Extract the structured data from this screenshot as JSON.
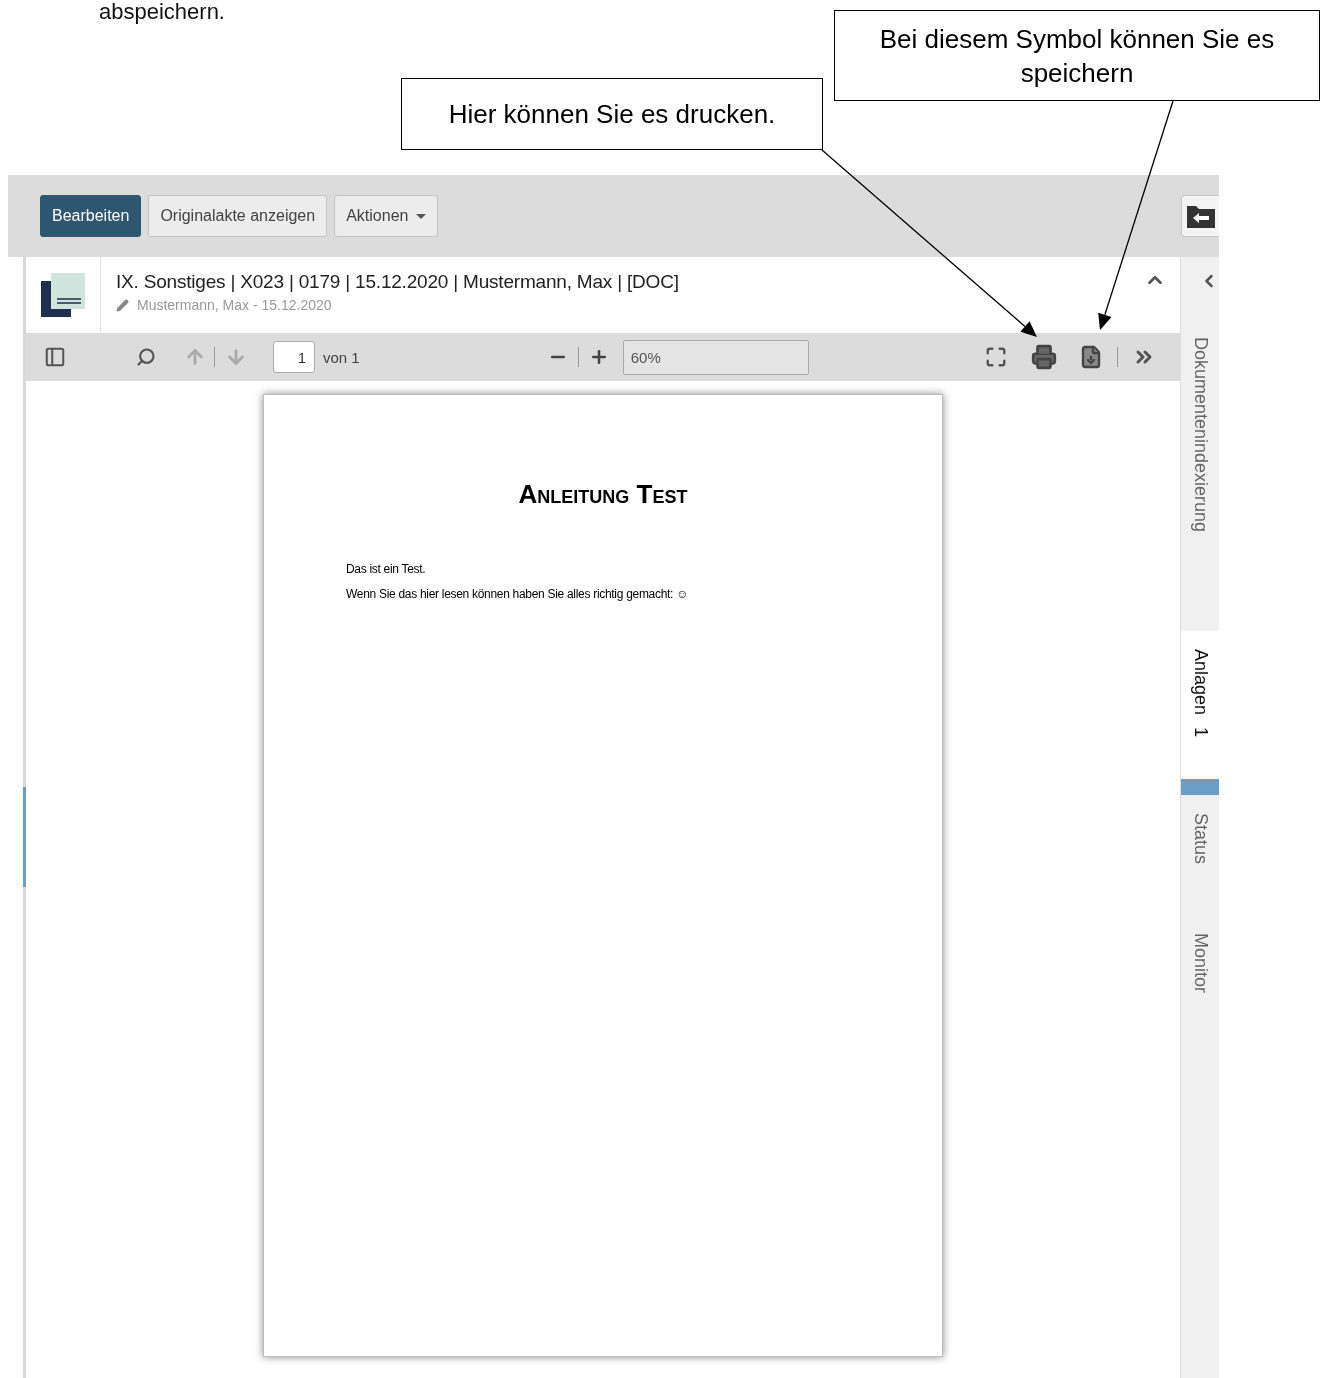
{
  "intro_fragment": "abspeichern.",
  "callouts": [
    {
      "text": "Hier können Sie es drucken."
    },
    {
      "text": "Bei diesem Symbol können Sie es speichern"
    }
  ],
  "toolbar": {
    "buttons": [
      {
        "label": "Bearbeiten",
        "kind": "primary"
      },
      {
        "label": "Originalakte anzeigen",
        "kind": "default"
      },
      {
        "label": "Aktionen",
        "kind": "dropdown"
      }
    ]
  },
  "document": {
    "title": "IX. Sonstiges | X023 | 0179 | 15.12.2020 | Mustermann, Max | [DOC]",
    "meta": "Mustermann, Max - 15.12.2020"
  },
  "viewer": {
    "page": "1",
    "page_total": "von 1",
    "zoom": "60%"
  },
  "page": {
    "heading": "Anleitung Test",
    "paragraphs": [
      "Das ist ein Test.",
      "Wenn Sie das hier lesen können haben Sie alles richtig gemacht: ☺"
    ]
  },
  "side_tabs": [
    {
      "label": "Dokumentenindexierung",
      "selected": false
    },
    {
      "label": "Anlagen",
      "count": "1",
      "selected": true
    },
    {
      "label": "Status",
      "selected": false
    },
    {
      "label": "Monitor",
      "selected": false
    }
  ]
}
